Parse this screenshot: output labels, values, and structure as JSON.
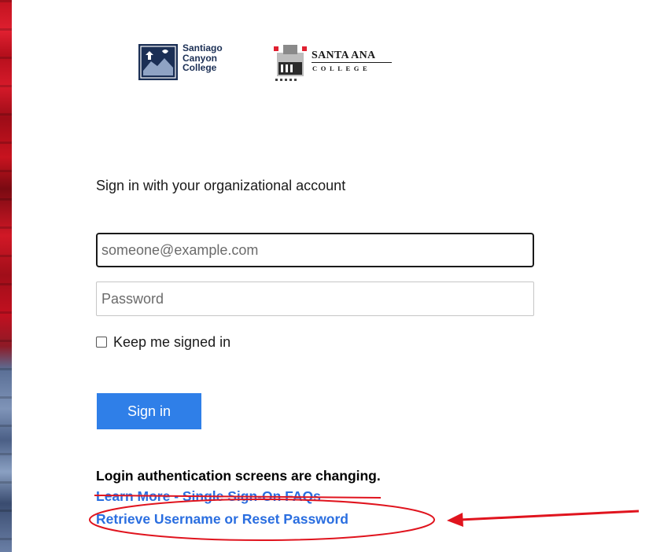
{
  "logos": {
    "santiago": {
      "lines": [
        "Santiago",
        "Canyon",
        "College"
      ],
      "color": "#1b2f55"
    },
    "santa_ana": {
      "line1": "SANTA ANA",
      "line2": "COLLEGE",
      "accent": "#e02030"
    }
  },
  "signin": {
    "heading": "Sign in with your organizational account",
    "email_placeholder": "someone@example.com",
    "password_placeholder": "Password",
    "keep_signed_in_label": "Keep me signed in",
    "keep_signed_in_checked": false,
    "button_label": "Sign in"
  },
  "footer": {
    "notice": "Login authentication screens are changing.",
    "faq_link": "Learn More - Single Sign-On FAQs",
    "reset_link": "Retrieve Username or Reset Password"
  },
  "colors": {
    "primary_button": "#2f7fe8",
    "link": "#2a6ee0",
    "annotation": "#e0141e"
  },
  "icons": [
    "santiago-canyon-logo-icon",
    "santa-ana-logo-icon",
    "checkbox-icon",
    "annotation-arrow-icon"
  ]
}
